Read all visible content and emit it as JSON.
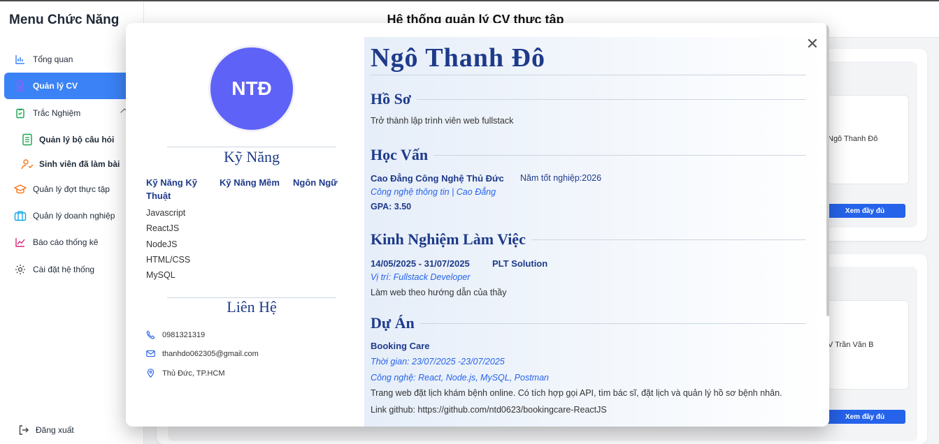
{
  "sidebar": {
    "title": "Menu Chức Năng",
    "items": [
      {
        "label": "Tổng quan",
        "icon": "bar-chart-icon"
      },
      {
        "label": "Quản lý CV",
        "icon": "document-icon"
      },
      {
        "label": "Trắc Nghiệm",
        "icon": "clipboard-icon"
      },
      {
        "label": "Quản lý đợt thực tập",
        "icon": "graduation-cap-icon"
      },
      {
        "label": "Quản lý doanh nghiệp",
        "icon": "briefcase-icon"
      },
      {
        "label": "Báo cáo thống kê",
        "icon": "line-chart-icon"
      },
      {
        "label": "Cài đặt hệ thống",
        "icon": "gear-icon"
      }
    ],
    "sub_items": [
      {
        "label": "Quản lý bộ câu hỏi",
        "icon": "list-icon"
      },
      {
        "label": "Sinh viên đã làm bài",
        "icon": "user-check-icon"
      }
    ],
    "logout": "Đăng xuất"
  },
  "header": {
    "title": "Hệ thống quản lý CV thực tập"
  },
  "background_cards": [
    {
      "name": "Ngô Thanh Đô",
      "button": "Xem đầy đủ"
    },
    {
      "name": "V Trần Văn B",
      "button": "Xem đầy đủ"
    }
  ],
  "cv": {
    "initials": "NTĐ",
    "name": "Ngô Thanh Đô",
    "skills_title": "Kỹ Năng",
    "skill_columns": [
      "Kỹ Năng Kỹ Thuật",
      "Kỹ Năng Mềm",
      "Ngôn Ngữ"
    ],
    "tech_skills": [
      "Javascript",
      "ReactJS",
      "NodeJS",
      "HTML/CSS",
      "MySQL"
    ],
    "contact_title": "Liên Hệ",
    "phone": "0981321319",
    "email": "thanhdo062305@gmail.com",
    "address": "Thủ Đức, TP.HCM",
    "profile_title": "Hồ Sơ",
    "profile_text": "Trở thành lập trình viên web fullstack",
    "education_title": "Học Vấn",
    "school": "Cao Đẳng Công Nghệ Thủ Đức",
    "grad_year": "Năm tốt nghiệp:2026",
    "major": "Công nghệ thông tin | Cao Đẳng",
    "gpa": "GPA: 3.50",
    "experience_title": "Kinh Nghiệm Làm Việc",
    "exp_period": "14/05/2025 - 31/07/2025",
    "exp_company": "PLT Solution",
    "exp_position": "Vị trí: Fullstack Developer",
    "exp_desc": "Làm web theo hướng dẫn của thầy",
    "projects_title": "Dự Án",
    "project_name": "Booking Care",
    "project_time": "Thời gian: 23/07/2025 -23/07/2025",
    "project_tech": "Công nghệ: React, Node.js, MySQL, Postman",
    "project_desc": "Trang web đặt lịch khám bệnh online. Có tích hợp gọi API, tìm bác sĩ, đặt lịch và quản lý hồ sơ bệnh nhân.",
    "project_link": "Link github: https://github.com/ntd0623/bookingcare-ReactJS"
  },
  "colors": {
    "accent": "#3b82f6",
    "heading": "#1e3a8a",
    "avatar": "#5f62f7"
  }
}
